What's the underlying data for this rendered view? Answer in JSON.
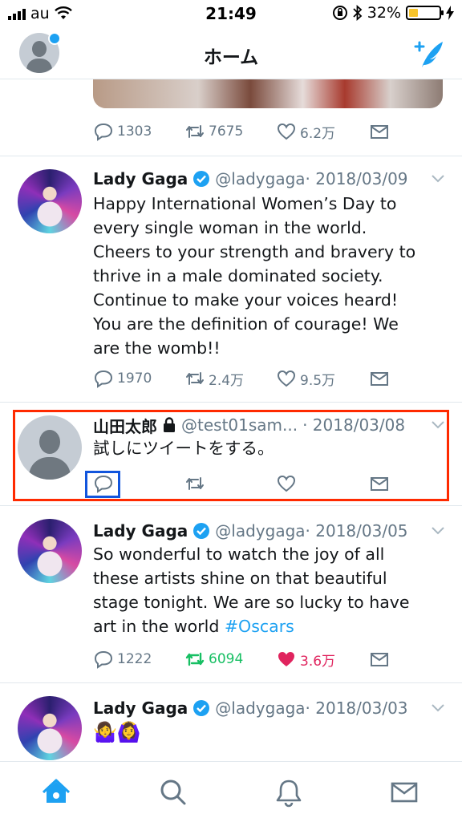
{
  "status_bar": {
    "carrier": "au",
    "time": "21:49",
    "battery_percent": "32%"
  },
  "nav": {
    "title": "ホーム",
    "icons": [
      "profile-avatar",
      "compose-tweet-icon"
    ]
  },
  "previous_tweet_actions": {
    "reply_count": "1303",
    "retweet_count": "7675",
    "like_count": "6.2万"
  },
  "tweets": [
    {
      "name": "Lady Gaga",
      "verified": true,
      "handle": "@ladygaga",
      "date": "· 2018/03/09",
      "text_lines": [
        "Happy International Women’s Day to",
        "every single woman in the world.",
        "Cheers to your strength and bravery to",
        "thrive in a male dominated society.",
        "Continue to make your voices heard!",
        "You are the definition of courage! We",
        "are the womb!!"
      ],
      "reply_count": "1970",
      "retweet_count": "2.4万",
      "like_count": "9.5万"
    },
    {
      "name": "山田太郎",
      "protected": true,
      "handle": "@test01sam...",
      "date": "· 2018/03/08",
      "text": "試しにツイートをする。",
      "reply_count": "",
      "retweet_count": "",
      "like_count": ""
    },
    {
      "name": "Lady Gaga",
      "verified": true,
      "handle": "@ladygaga",
      "date": "· 2018/03/05",
      "text_lines": [
        "So wonderful to watch the joy of all",
        "these artists shine on that beautiful",
        "stage tonight. We are so lucky to have"
      ],
      "last_line_prefix": "art in the world ",
      "hashtag": "#Oscars",
      "reply_count": "1222",
      "retweet_count": "6094",
      "like_count": "3.6万",
      "retweeted": true,
      "liked": true
    },
    {
      "name": "Lady Gaga",
      "verified": true,
      "handle": "@ladygaga",
      "date": "· 2018/03/03",
      "emoji": "🤷‍♀️🙆‍♀️"
    }
  ],
  "tab_bar": {
    "tabs": [
      "home-tab",
      "search-tab",
      "notifications-tab",
      "messages-tab"
    ],
    "active": "home-tab"
  },
  "colors": {
    "accent": "#1da1f2",
    "retweet_green": "#17bf63",
    "like_red": "#e0245e",
    "highlight_red": "#ff2a00",
    "highlight_blue": "#1155dd"
  }
}
